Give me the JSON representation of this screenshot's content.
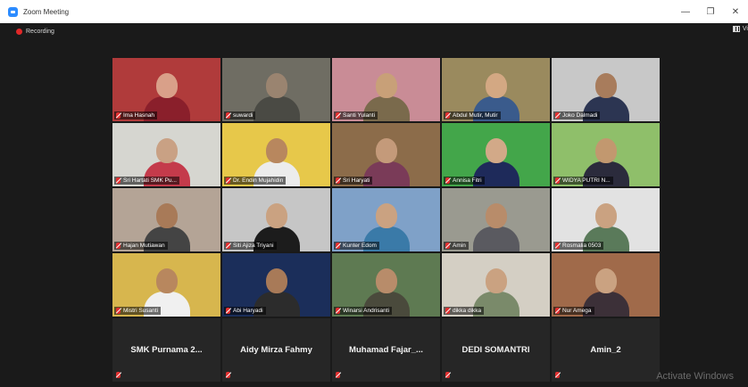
{
  "window": {
    "title": "Zoom Meeting"
  },
  "toolbar": {
    "recording_label": "Recording",
    "view_label": "Vi"
  },
  "participants": [
    {
      "name": "Ima Hasnah",
      "bg": "#b03b3b",
      "skin": "#d9a089",
      "shirt": "#8a1f2b"
    },
    {
      "name": "suwardi",
      "bg": "#6f6d63",
      "skin": "#9a8470",
      "shirt": "#4a4a44"
    },
    {
      "name": "Santi Yulanti",
      "bg": "#c98c96",
      "skin": "#c8a078",
      "shirt": "#7a6a4c"
    },
    {
      "name": "Abdul Mutir, Mutir",
      "bg": "#9a8a5e",
      "skin": "#d3a883",
      "shirt": "#3a5b8c"
    },
    {
      "name": "Joko Dalmadi",
      "bg": "#c8c8c8",
      "skin": "#a87c5c",
      "shirt": "#2c3552"
    },
    {
      "name": "Sri Hartati SMK Pu...",
      "bg": "#d6d6d0",
      "skin": "#c9a184",
      "shirt": "#c43b4b"
    },
    {
      "name": "Dr. Endin Mujahidin",
      "bg": "#e7c84a",
      "skin": "#b8875e",
      "shirt": "#ececec"
    },
    {
      "name": "Sri Haryati",
      "bg": "#8c6c4a",
      "skin": "#c49a7a",
      "shirt": "#7a3b58"
    },
    {
      "name": "Annisa Fitri",
      "bg": "#43a64a",
      "skin": "#d2a988",
      "shirt": "#1e2a5a"
    },
    {
      "name": "WIDYA PUTRI N...",
      "bg": "#8fbf6a",
      "skin": "#c2986f",
      "shirt": "#2b2b3c"
    },
    {
      "name": "Hajan Mutiawan",
      "bg": "#b4a496",
      "skin": "#a87a58",
      "shirt": "#444444"
    },
    {
      "name": "Siti Ajiza Triyani",
      "bg": "#c6c6c6",
      "skin": "#caa281",
      "shirt": "#1c1c1c"
    },
    {
      "name": "Kunter Edom",
      "bg": "#7fa1c8",
      "skin": "#caa281",
      "shirt": "#3a7aa8"
    },
    {
      "name": "Amin",
      "bg": "#9a9a90",
      "skin": "#b88c6a",
      "shirt": "#5a5a60"
    },
    {
      "name": "Rosmalia 0503",
      "bg": "#e2e2e2",
      "skin": "#caa281",
      "shirt": "#5a7a5a"
    },
    {
      "name": "Mistri Susanti",
      "bg": "#d7b64e",
      "skin": "#b8875e",
      "shirt": "#f0f0f0"
    },
    {
      "name": "Abi Haryadi",
      "bg": "#1b2e5a",
      "skin": "#a87a58",
      "shirt": "#2c2c2c"
    },
    {
      "name": "Winarsi Andrisanti",
      "bg": "#5e7a52",
      "skin": "#b88c6a",
      "shirt": "#4a4a3c"
    },
    {
      "name": "dikka dikka",
      "bg": "#d4cfc4",
      "skin": "#caa281",
      "shirt": "#7a8a6a"
    },
    {
      "name": "Nur Amega",
      "bg": "#a06a4a",
      "skin": "#caa281",
      "shirt": "#3c3038"
    }
  ],
  "text_participants": [
    {
      "name": "SMK Purnama 2..."
    },
    {
      "name": "Aidy Mirza Fahmy"
    },
    {
      "name": "Muhamad Fajar_..."
    },
    {
      "name": "DEDI SOMANTRI"
    },
    {
      "name": "Amin_2"
    }
  ],
  "watermark": "Activate Windows"
}
